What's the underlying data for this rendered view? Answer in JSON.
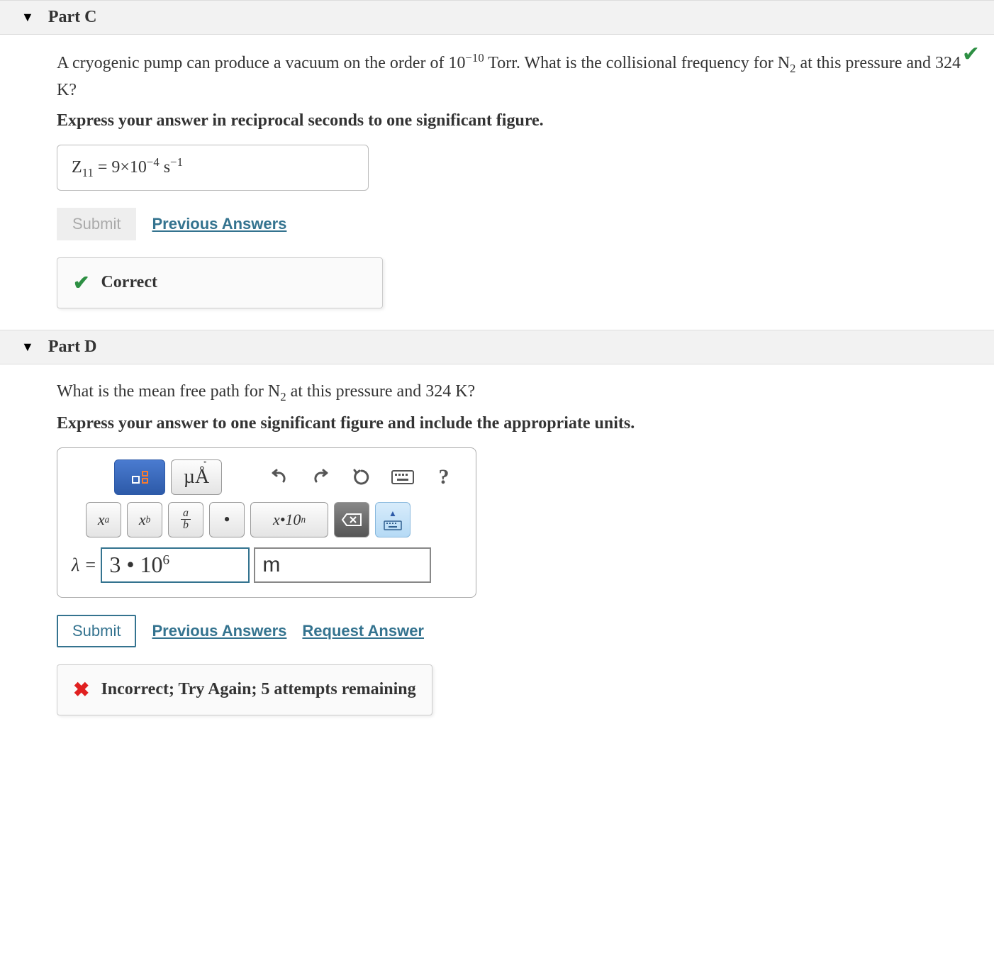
{
  "partC": {
    "title": "Part C",
    "question_html": "A cryogenic pump can produce a vacuum on the order of 10<sup>−10</sup>  Torr. What is the collisional frequency for N<sub>2</sub> at this pressure and 324 K?",
    "instruction": "Express your answer in reciprocal seconds to one significant figure.",
    "answer_html": "Z<sub>11</sub>  =  9×10<sup>−4</sup>  s<sup>−1</sup>",
    "submit_label": "Submit",
    "prev_label": "Previous Answers",
    "feedback": "Correct"
  },
  "partD": {
    "title": "Part D",
    "question_html": "What is the mean free path for N<sub>2</sub> at this pressure and 324 K?",
    "instruction": "Express your answer to one significant figure and include the appropriate units.",
    "toolbar": {
      "units_btn": "µÅ",
      "help": "?",
      "sup_btn": "x",
      "sup_exp": "a",
      "sub_btn": "x",
      "sub_exp": "b",
      "frac_top": "a",
      "frac_bot": "b",
      "dot": "•",
      "sci_btn": "x•10",
      "sci_exp": "n",
      "backspace": "⌫"
    },
    "var_label": "λ = ",
    "value_html": "3 • 10<sup style='font-size:60%'>6</sup>",
    "unit_html": "m",
    "submit_label": "Submit",
    "prev_label": "Previous Answers",
    "request_label": "Request Answer",
    "feedback": "Incorrect; Try Again; 5 attempts remaining"
  }
}
